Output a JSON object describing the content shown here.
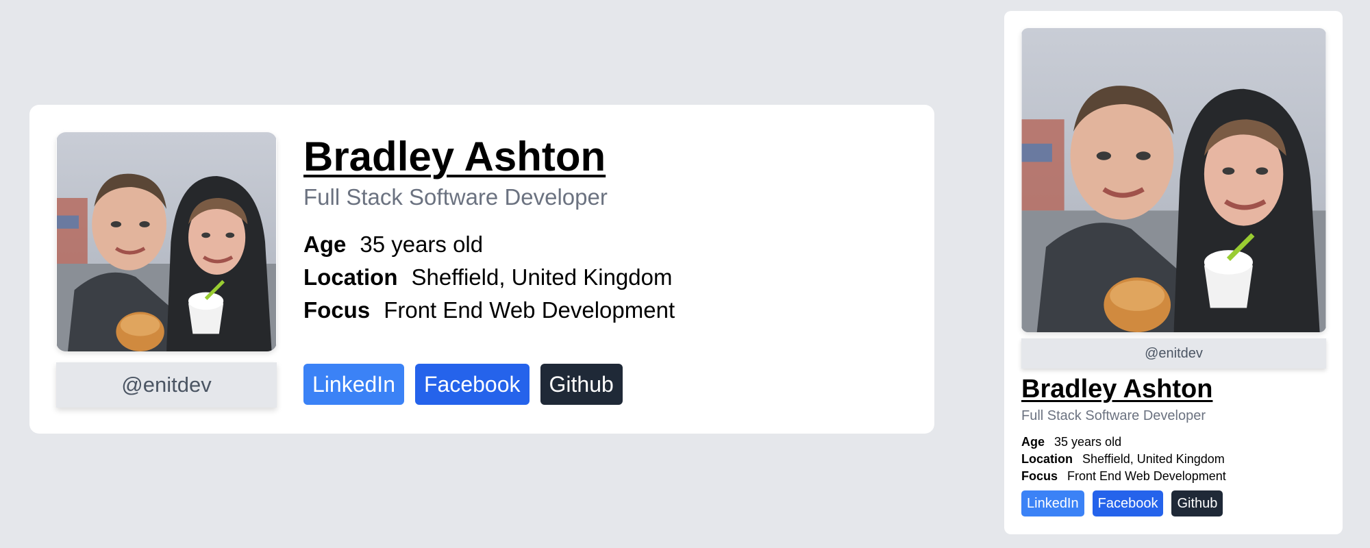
{
  "profile": {
    "name": "Bradley Ashton",
    "title": "Full Stack Software Developer",
    "handle": "@enitdev",
    "details": [
      {
        "label": "Age",
        "value": "35 years old"
      },
      {
        "label": "Location",
        "value": "Sheffield, United Kingdom"
      },
      {
        "label": "Focus",
        "value": "Front End Web Development"
      }
    ],
    "links": [
      {
        "label": "LinkedIn",
        "color": "#3b82f6"
      },
      {
        "label": "Facebook",
        "color": "#2563eb"
      },
      {
        "label": "Github",
        "color": "#1f2937"
      }
    ],
    "photo": {
      "icon": "profile-photo-two-people-selfie"
    }
  },
  "colors": {
    "page_background": "#e5e7eb",
    "card_background": "#ffffff",
    "muted_text": "#6b7280",
    "handle_background": "#e5e7eb"
  }
}
